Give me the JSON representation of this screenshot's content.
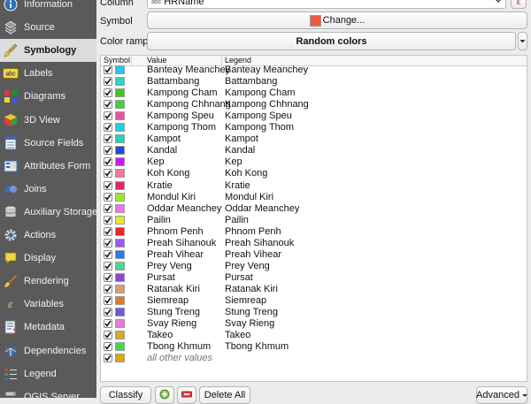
{
  "sidebar": {
    "items": [
      {
        "name": "information",
        "label": "Information",
        "icon": "info-icon",
        "active": false
      },
      {
        "name": "source",
        "label": "Source",
        "icon": "source-icon",
        "active": false
      },
      {
        "name": "symbology",
        "label": "Symbology",
        "icon": "paintbrush-icon",
        "active": true
      },
      {
        "name": "labels",
        "label": "Labels",
        "icon": "labels-abc-icon",
        "active": false
      },
      {
        "name": "diagrams",
        "label": "Diagrams",
        "icon": "diagrams-icon",
        "active": false
      },
      {
        "name": "3d-view",
        "label": "3D View",
        "icon": "cube-icon",
        "active": false
      },
      {
        "name": "source-fields",
        "label": "Source Fields",
        "icon": "fields-icon",
        "active": false
      },
      {
        "name": "attributes-form",
        "label": "Attributes Form",
        "icon": "form-icon",
        "active": false
      },
      {
        "name": "joins",
        "label": "Joins",
        "icon": "joins-icon",
        "active": false
      },
      {
        "name": "auxiliary-storage",
        "label": "Auxiliary Storage",
        "icon": "storage-icon",
        "active": false
      },
      {
        "name": "actions",
        "label": "Actions",
        "icon": "actions-gear-icon",
        "active": false
      },
      {
        "name": "display",
        "label": "Display",
        "icon": "speech-bubble-icon",
        "active": false
      },
      {
        "name": "rendering",
        "label": "Rendering",
        "icon": "rendering-brush-icon",
        "active": false
      },
      {
        "name": "variables",
        "label": "Variables",
        "icon": "variables-icon",
        "active": false
      },
      {
        "name": "metadata",
        "label": "Metadata",
        "icon": "metadata-icon",
        "active": false
      },
      {
        "name": "dependencies",
        "label": "Dependencies",
        "icon": "dependencies-icon",
        "active": false
      },
      {
        "name": "legend",
        "label": "Legend",
        "icon": "legend-icon",
        "active": false
      },
      {
        "name": "qgis-server",
        "label": "QGIS Server",
        "icon": "server-icon",
        "active": false
      }
    ]
  },
  "column": {
    "label": "Column",
    "type_badge": "abc",
    "value": "HRName",
    "expr_icon": "ε"
  },
  "symbol": {
    "label": "Symbol",
    "button_label": "Change...",
    "swatch_color": "#f05a3a"
  },
  "color_ramp": {
    "label": "Color ramp",
    "value": "Random colors"
  },
  "table": {
    "headers": {
      "symbol": "Symbol",
      "value": "Value",
      "legend": "Legend"
    },
    "rows": [
      {
        "value": "Banteay Meanchey",
        "legend": "Banteay Meanchey",
        "color": "#2ec4e8"
      },
      {
        "value": "Battambang",
        "legend": "Battambang",
        "color": "#2fd3c8"
      },
      {
        "value": "Kampong Cham",
        "legend": "Kampong Cham",
        "color": "#48c21f"
      },
      {
        "value": "Kampong Chhnang",
        "legend": "Kampong Chhnang",
        "color": "#3ed23a"
      },
      {
        "value": "Kampong Speu",
        "legend": "Kampong Speu",
        "color": "#ea4fa2"
      },
      {
        "value": "Kampong Thom",
        "legend": "Kampong Thom",
        "color": "#25cde4"
      },
      {
        "value": "Kampot",
        "legend": "Kampot",
        "color": "#23d6b0"
      },
      {
        "value": "Kandal",
        "legend": "Kandal",
        "color": "#2447d6"
      },
      {
        "value": "Kep",
        "legend": "Kep",
        "color": "#c31ff0"
      },
      {
        "value": "Koh Kong",
        "legend": "Koh Kong",
        "color": "#f07a9e"
      },
      {
        "value": "Kratie",
        "legend": "Kratie",
        "color": "#e0256a"
      },
      {
        "value": "Mondul Kiri",
        "legend": "Mondul Kiri",
        "color": "#9ee62a"
      },
      {
        "value": "Oddar Meanchey",
        "legend": "Oddar Meanchey",
        "color": "#e879e0"
      },
      {
        "value": "Pailin",
        "legend": "Pailin",
        "color": "#e8e82a"
      },
      {
        "value": "Phnom Penh",
        "legend": "Phnom Penh",
        "color": "#e82424"
      },
      {
        "value": "Preah Sihanouk",
        "legend": "Preah Sihanouk",
        "color": "#9a5de8"
      },
      {
        "value": "Preah Vihear",
        "legend": "Preah Vihear",
        "color": "#2a7ae8"
      },
      {
        "value": "Prey Veng",
        "legend": "Prey Veng",
        "color": "#49d99a"
      },
      {
        "value": "Pursat",
        "legend": "Pursat",
        "color": "#8e47d0"
      },
      {
        "value": "Ratanak Kiri",
        "legend": "Ratanak Kiri",
        "color": "#d8a070"
      },
      {
        "value": "Siemreap",
        "legend": "Siemreap",
        "color": "#e07a2a"
      },
      {
        "value": "Stung Treng",
        "legend": "Stung Treng",
        "color": "#6a5ad8"
      },
      {
        "value": "Svay Rieng",
        "legend": "Svay Rieng",
        "color": "#e87ad8"
      },
      {
        "value": "Takeo",
        "legend": "Takeo",
        "color": "#d6aa2a"
      },
      {
        "value": "Tbong Khmum",
        "legend": "Tbong Khmum",
        "color": "#40d84a"
      },
      {
        "value": "all other values",
        "legend": "",
        "color": "#d8a810",
        "italic": true
      }
    ]
  },
  "bottom": {
    "classify_label": "Classify",
    "add_icon": "add-class-icon",
    "remove_icon": "remove-class-icon",
    "delete_all_label": "Delete All",
    "advanced_label": "Advanced"
  }
}
